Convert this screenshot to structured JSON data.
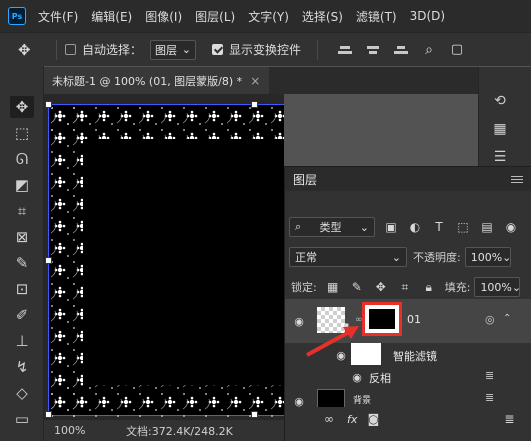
{
  "app": {
    "logo": "Ps"
  },
  "menu": [
    "文件(F)",
    "编辑(E)",
    "图像(I)",
    "图层(L)",
    "文字(Y)",
    "选择(S)",
    "滤镜(T)",
    "3D(D)"
  ],
  "options_bar": {
    "auto_select_label": "自动选择：",
    "auto_select_value": "图层",
    "show_transform_label": "显示变换控件"
  },
  "document": {
    "tab_title": "未标题-1 @ 100% (01, 图层蒙版/8) *",
    "close_symbol": "×",
    "zoom": "100%",
    "doc_size": "文档:372.4K/248.2K"
  },
  "layers_panel": {
    "title": "图层",
    "filter_kind": "类型",
    "blend_mode": "正常",
    "opacity_label": "不透明度:",
    "opacity_value": "100%",
    "lock_label": "锁定:",
    "fill_label": "填充:",
    "fill_value": "100%",
    "layers": [
      {
        "name": "01"
      },
      {
        "name": "智能滤镜"
      },
      {
        "name": "反相"
      },
      {
        "name": "背景"
      }
    ],
    "bottom_fx": "fx"
  },
  "colors": {
    "accent_red": "#e8302a",
    "selection_blue": "#3d5afe",
    "panel_bg": "#323232",
    "menubar_bg": "#2b2b2b"
  },
  "icons": [
    "move-tool-icon",
    "marquee-icon",
    "lasso-icon",
    "object-select-icon",
    "crop-icon",
    "frame-icon",
    "eyedropper-icon",
    "patch-icon",
    "brush-icon",
    "stamp-icon",
    "eraser-icon",
    "gradient-icon",
    "history-icon",
    "table-icon",
    "adjust-icon",
    "search-icon",
    "eye-icon",
    "link-icon"
  ]
}
